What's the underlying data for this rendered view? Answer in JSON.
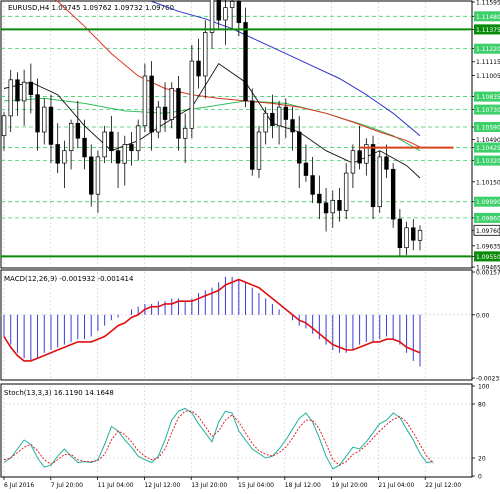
{
  "chart_data": {
    "type": "candlestick",
    "main": {
      "symbol_line": "EURUSD,H4  1.09745 1.09762 1.09732 1.09760",
      "current_price_label": "1.09760",
      "ylim": [
        1.09465,
        1.11595
      ],
      "price_ticks": [
        "1.11595",
        "1.11480",
        "1.11375",
        "1.11220",
        "1.11115",
        "1.11005",
        "1.10835",
        "1.10730",
        "1.10590",
        "1.10490",
        "1.10425",
        "1.10320",
        "1.10150",
        "1.09990",
        "1.09860",
        "1.09760",
        "1.09635",
        "1.09550",
        "1.09465"
      ],
      "highlighted_ticks": [
        "1.11480",
        "1.11375",
        "1.11220",
        "1.10835",
        "1.10730",
        "1.10590",
        "1.10425",
        "1.10320",
        "1.09990",
        "1.09860",
        "1.09760",
        "1.09550"
      ],
      "levels": [
        {
          "name": "resistance",
          "value": 1.11375,
          "color": "#0a8a0a"
        },
        {
          "name": "support",
          "value": 1.0955,
          "color": "#0a8a0a"
        },
        {
          "name": "short-resistance",
          "value": 1.10425,
          "color": "#d84315",
          "x_from_index": 53,
          "x_to_index": 67
        }
      ],
      "fib_levels": [
        1.1148,
        1.1122,
        1.10835,
        1.1073,
        1.1059,
        1.10425,
        1.1032,
        1.0999,
        1.0986
      ],
      "candles": [
        [
          1.1052,
          1.1071,
          1.104,
          1.1068
        ],
        [
          1.1068,
          1.1105,
          1.1055,
          1.1097
        ],
        [
          1.1097,
          1.1103,
          1.1068,
          1.108
        ],
        [
          1.108,
          1.1105,
          1.106,
          1.1095
        ],
        [
          1.1095,
          1.111,
          1.107,
          1.1085
        ],
        [
          1.1085,
          1.1098,
          1.104,
          1.1055
        ],
        [
          1.1055,
          1.1082,
          1.1045,
          1.1075
        ],
        [
          1.1075,
          1.1085,
          1.103,
          1.1045
        ],
        [
          1.1045,
          1.1062,
          1.1022,
          1.103
        ],
        [
          1.103,
          1.1048,
          1.101,
          1.104
        ],
        [
          1.104,
          1.1065,
          1.1025,
          1.1062
        ],
        [
          1.1062,
          1.108,
          1.1042,
          1.105
        ],
        [
          1.105,
          1.1065,
          1.1025,
          1.1035
        ],
        [
          1.1035,
          1.1045,
          1.0995,
          1.1005
        ],
        [
          1.1005,
          1.104,
          1.099,
          1.1035
        ],
        [
          1.1035,
          1.106,
          1.103,
          1.1055
        ],
        [
          1.1055,
          1.1068,
          1.103,
          1.104
        ],
        [
          1.104,
          1.1055,
          1.101,
          1.103
        ],
        [
          1.103,
          1.1052,
          1.1012,
          1.1045
        ],
        [
          1.1045,
          1.1055,
          1.1028,
          1.104
        ],
        [
          1.104,
          1.1065,
          1.1032,
          1.106
        ],
        [
          1.106,
          1.111,
          1.1055,
          1.11
        ],
        [
          1.11,
          1.1112,
          1.104,
          1.1055
        ],
        [
          1.1055,
          1.108,
          1.105,
          1.1075
        ],
        [
          1.1075,
          1.1095,
          1.1055,
          1.1065
        ],
        [
          1.1065,
          1.1095,
          1.1058,
          1.109
        ],
        [
          1.109,
          1.11,
          1.104,
          1.105
        ],
        [
          1.105,
          1.107,
          1.103,
          1.1058
        ],
        [
          1.1058,
          1.1125,
          1.105,
          1.1112
        ],
        [
          1.1112,
          1.113,
          1.109,
          1.11
        ],
        [
          1.11,
          1.1145,
          1.1082,
          1.1135
        ],
        [
          1.1135,
          1.1175,
          1.1122,
          1.1162
        ],
        [
          1.1162,
          1.1178,
          1.1138,
          1.1145
        ],
        [
          1.1145,
          1.1168,
          1.1125,
          1.1155
        ],
        [
          1.1155,
          1.1175,
          1.1138,
          1.116
        ],
        [
          1.116,
          1.1168,
          1.1132,
          1.1143
        ],
        [
          1.1143,
          1.1155,
          1.1075,
          1.108
        ],
        [
          1.108,
          1.109,
          1.102,
          1.1025
        ],
        [
          1.1025,
          1.106,
          1.1018,
          1.1055
        ],
        [
          1.1055,
          1.1075,
          1.1045,
          1.107
        ],
        [
          1.107,
          1.1085,
          1.105,
          1.106
        ],
        [
          1.106,
          1.108,
          1.1045,
          1.1075
        ],
        [
          1.1075,
          1.1082,
          1.105,
          1.1065
        ],
        [
          1.1065,
          1.1075,
          1.104,
          1.1055
        ],
        [
          1.1055,
          1.1068,
          1.101,
          1.103
        ],
        [
          1.103,
          1.1045,
          1.1015,
          1.102
        ],
        [
          1.102,
          1.1035,
          1.0998,
          1.1005
        ],
        [
          1.1005,
          1.102,
          1.0985,
          1.0998
        ],
        [
          1.0998,
          1.101,
          1.0975,
          1.099
        ],
        [
          1.099,
          1.1008,
          1.0978,
          1.1
        ],
        [
          1.1,
          1.101,
          1.0983,
          1.0992
        ],
        [
          1.0992,
          1.103,
          1.0985,
          1.1022
        ],
        [
          1.1022,
          1.1045,
          1.101,
          1.104
        ],
        [
          1.104,
          1.106,
          1.1025,
          1.103
        ],
        [
          1.103,
          1.105,
          1.102,
          1.1045
        ],
        [
          1.1045,
          1.1052,
          1.0985,
          1.0995
        ],
        [
          1.0995,
          1.104,
          1.099,
          1.1035
        ],
        [
          1.1035,
          1.1045,
          1.1018,
          1.1025
        ],
        [
          1.1025,
          1.103,
          1.0978,
          1.0985
        ],
        [
          1.0985,
          1.0993,
          1.0955,
          1.0962
        ],
        [
          1.0962,
          1.0983,
          1.0956,
          1.0978
        ],
        [
          1.0978,
          1.0985,
          1.096,
          1.0968
        ],
        [
          1.0968,
          1.098,
          1.096,
          1.0976
        ]
      ],
      "ma_blue": [
        [
          22,
          1.116
        ],
        [
          26,
          1.1152
        ],
        [
          30,
          1.1146
        ],
        [
          34,
          1.1138
        ],
        [
          38,
          1.1128
        ],
        [
          42,
          1.1118
        ],
        [
          46,
          1.1108
        ],
        [
          50,
          1.1098
        ],
        [
          54,
          1.1085
        ],
        [
          58,
          1.107
        ],
        [
          62,
          1.1052
        ]
      ],
      "ma_red": [
        [
          0,
          1.119
        ],
        [
          4,
          1.1175
        ],
        [
          8,
          1.116
        ],
        [
          12,
          1.114
        ],
        [
          16,
          1.1118
        ],
        [
          20,
          1.11
        ],
        [
          24,
          1.109
        ],
        [
          28,
          1.1085
        ],
        [
          32,
          1.1082
        ],
        [
          36,
          1.108
        ],
        [
          40,
          1.1078
        ],
        [
          44,
          1.1075
        ],
        [
          48,
          1.107
        ],
        [
          52,
          1.1063
        ],
        [
          56,
          1.1055
        ],
        [
          60,
          1.1048
        ],
        [
          62,
          1.1043
        ]
      ],
      "ma_green": [
        [
          0,
          1.108
        ],
        [
          6,
          1.1082
        ],
        [
          12,
          1.1078
        ],
        [
          18,
          1.1072
        ],
        [
          24,
          1.107
        ],
        [
          30,
          1.1075
        ],
        [
          36,
          1.108
        ],
        [
          42,
          1.1078
        ],
        [
          48,
          1.107
        ],
        [
          54,
          1.106
        ],
        [
          58,
          1.1052
        ],
        [
          62,
          1.104
        ]
      ],
      "ma_black": [
        [
          0,
          1.109
        ],
        [
          4,
          1.1095
        ],
        [
          8,
          1.1085
        ],
        [
          12,
          1.106
        ],
        [
          16,
          1.104
        ],
        [
          20,
          1.1048
        ],
        [
          24,
          1.1062
        ],
        [
          28,
          1.1075
        ],
        [
          32,
          1.111
        ],
        [
          36,
          1.1095
        ],
        [
          40,
          1.1062
        ],
        [
          44,
          1.1055
        ],
        [
          48,
          1.104
        ],
        [
          52,
          1.103
        ],
        [
          56,
          1.104
        ],
        [
          60,
          1.1028
        ],
        [
          62,
          1.1018
        ]
      ]
    },
    "macd": {
      "label": "MACD(12,26,9) -0.001932 -0.001414",
      "ticks": [
        "0.001578",
        "0.00",
        "-0.002331"
      ],
      "ylim": [
        -0.002331,
        0.001578
      ],
      "histogram": [
        -0.0008,
        -0.0011,
        -0.0014,
        -0.0016,
        -0.0017,
        -0.0016,
        -0.0014,
        -0.0013,
        -0.0012,
        -0.0011,
        -0.001,
        -0.0009,
        -0.0009,
        -0.0008,
        -0.0006,
        -0.0004,
        -0.0002,
        -0.0001,
        0.0,
        0.0002,
        0.0003,
        0.0004,
        0.0004,
        0.0005,
        0.0005,
        0.0006,
        0.0006,
        0.0005,
        0.0006,
        0.0008,
        0.0009,
        0.001,
        0.0012,
        0.0014,
        0.0014,
        0.0013,
        0.0012,
        0.001,
        0.0008,
        0.0006,
        0.0004,
        0.0002,
        0.0,
        -0.0002,
        -0.0004,
        -0.0005,
        -0.0007,
        -0.0009,
        -0.0011,
        -0.0013,
        -0.0014,
        -0.0014,
        -0.0013,
        -0.0011,
        -0.001,
        -0.001,
        -0.0009,
        -0.0008,
        -0.0009,
        -0.0011,
        -0.0014,
        -0.0017,
        -0.0019
      ],
      "signal": [
        -0.0008,
        -0.0012,
        -0.0015,
        -0.0017,
        -0.0017,
        -0.0016,
        -0.0015,
        -0.0014,
        -0.0013,
        -0.0012,
        -0.0011,
        -0.001,
        -0.001,
        -0.001,
        -0.0009,
        -0.0008,
        -0.0006,
        -0.0004,
        -0.0003,
        -0.0001,
        0.0,
        0.0002,
        0.0003,
        0.0003,
        0.0004,
        0.0004,
        0.0005,
        0.0005,
        0.0005,
        0.0006,
        0.0007,
        0.0008,
        0.0009,
        0.0011,
        0.0012,
        0.0013,
        0.0012,
        0.0011,
        0.001,
        0.0008,
        0.0006,
        0.0004,
        0.0002,
        0.0,
        -0.0002,
        -0.0003,
        -0.0005,
        -0.0007,
        -0.0009,
        -0.0011,
        -0.0012,
        -0.0013,
        -0.0013,
        -0.0012,
        -0.0011,
        -0.001,
        -0.001,
        -0.0009,
        -0.0009,
        -0.001,
        -0.0012,
        -0.0013,
        -0.0014
      ]
    },
    "stoch": {
      "label": "Stoch(13,3,3) 16.1190 14.1648",
      "ticks": [
        "100",
        "80",
        "20",
        "0"
      ],
      "ylim": [
        0,
        100
      ],
      "k": [
        15,
        20,
        30,
        40,
        35,
        20,
        10,
        12,
        22,
        30,
        22,
        15,
        16,
        15,
        18,
        35,
        55,
        50,
        40,
        32,
        22,
        18,
        15,
        22,
        40,
        62,
        72,
        75,
        70,
        58,
        48,
        38,
        60,
        72,
        70,
        50,
        40,
        30,
        25,
        20,
        22,
        30,
        40,
        52,
        64,
        70,
        60,
        42,
        22,
        8,
        12,
        22,
        32,
        30,
        38,
        48,
        58,
        62,
        70,
        65,
        52,
        40,
        25,
        15,
        16
      ],
      "d": [
        18,
        20,
        26,
        32,
        35,
        28,
        18,
        13,
        18,
        24,
        24,
        18,
        16,
        16,
        17,
        24,
        40,
        50,
        46,
        38,
        28,
        22,
        18,
        20,
        30,
        48,
        65,
        72,
        72,
        66,
        55,
        44,
        50,
        62,
        68,
        60,
        48,
        36,
        28,
        24,
        22,
        26,
        32,
        42,
        54,
        62,
        62,
        52,
        36,
        18,
        12,
        16,
        24,
        28,
        34,
        42,
        50,
        57,
        63,
        66,
        60,
        48,
        35,
        22,
        14
      ]
    },
    "x_ticks": [
      "6 Jul 2016",
      "7 Jul 20:00",
      "11 Jul 04:00",
      "12 Jul 12:00",
      "13 Jul 20:00",
      "15 Jul 04:00",
      "18 Jul 12:00",
      "19 Jul 20:00",
      "21 Jul 04:00",
      "22 Jul 12:00"
    ],
    "colors": {
      "bull": "#ffffff",
      "bear": "#000000",
      "grid": "#c8c8c8",
      "ma_blue": "#2b35c8",
      "ma_red": "#d9341e",
      "ma_green": "#2fbf5a",
      "ma_black": "#111111",
      "fib": "#3ccf6a",
      "macd_hist": "#3a3ad8",
      "macd_signal": "#e01010",
      "stoch_k": "#1fb0a0",
      "stoch_d": "#e01010"
    }
  }
}
